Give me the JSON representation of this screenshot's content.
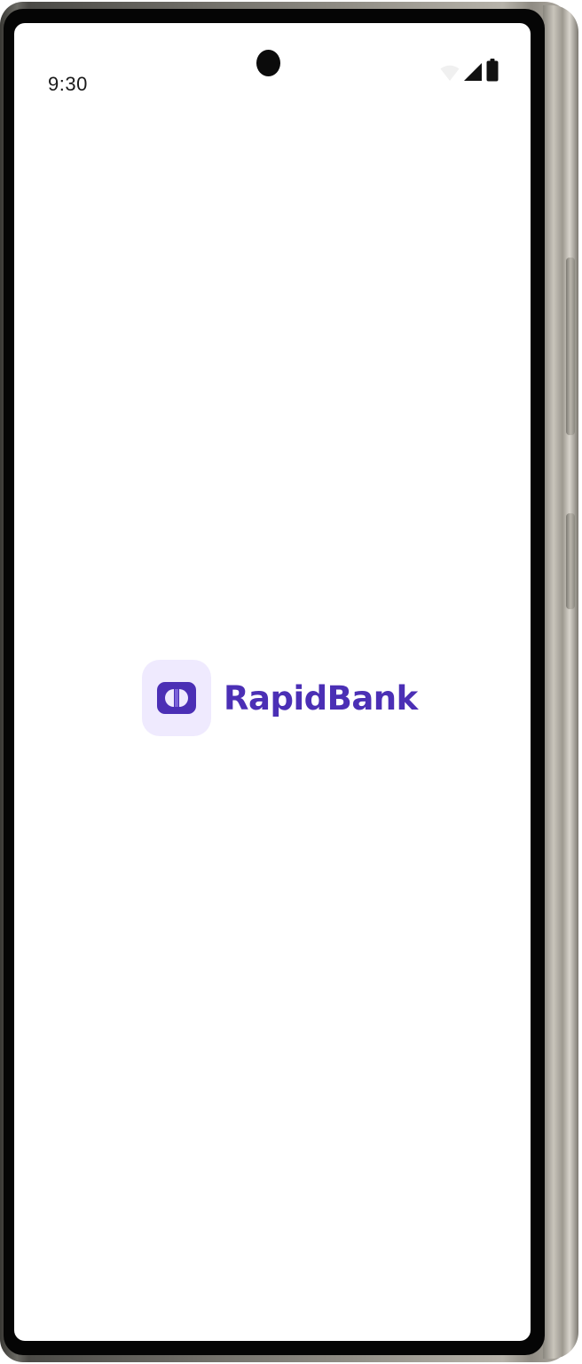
{
  "status_bar": {
    "time": "9:30",
    "icons": [
      "wifi-icon",
      "cellular-signal-icon",
      "battery-icon"
    ]
  },
  "splash": {
    "brand_name": "RapidBank",
    "logo_icon": "rapidbank-logo-icon"
  },
  "colors": {
    "brand": "#4b2fb5",
    "logo_tile": "#efeafe",
    "screen_background": "#ffffff",
    "bezel": "#050505"
  }
}
